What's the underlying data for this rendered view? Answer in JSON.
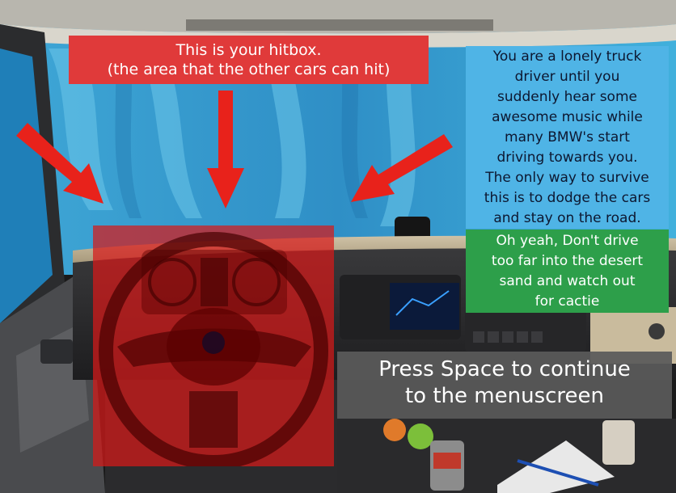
{
  "intro_screen": {
    "hitbox_label": {
      "line1": "This is your hitbox.",
      "line2": "(the area that the other cars can hit)"
    },
    "story_lines": [
      "You are a lonely truck",
      "driver until you",
      "suddenly hear some",
      "awesome music while",
      "many BMW's start",
      "driving towards you.",
      "The only way to survive",
      "this is to dodge the cars",
      "and stay on the road."
    ],
    "hint_lines": [
      "Oh yeah, Don't drive",
      "too far into the desert",
      "sand and watch out",
      "for cactie"
    ],
    "continue_lines": [
      "Press Space to continue",
      "to the menuscreen"
    ]
  },
  "colors": {
    "label_red": "#e03a3a",
    "story_blue": "#4fb4e6",
    "hint_green": "#2d9f4a",
    "prompt_gray": "#5a5a5a",
    "hitbox_red": "rgba(215,25,25,0.72)",
    "arrow_red": "#e8221b"
  },
  "icons": [
    "arrow-down-left-icon",
    "arrow-down-icon",
    "arrow-down-right-icon",
    "steering-wheel-icon",
    "scania-griffin-icon"
  ]
}
